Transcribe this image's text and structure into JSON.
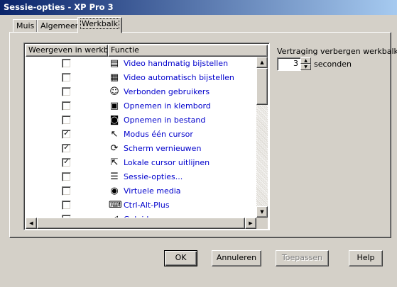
{
  "window": {
    "title": "Sessie-opties - XP Pro 3",
    "close_glyph": "×"
  },
  "tabs": [
    {
      "label": "Muis"
    },
    {
      "label": "Algemeen"
    },
    {
      "label": "Werkbalk",
      "active": true
    }
  ],
  "list": {
    "columns": [
      "Weergeven in werkb...",
      "Functie"
    ],
    "rows": [
      {
        "checked": "",
        "icon": "video-manual-icon",
        "label": "Video handmatig bijstellen"
      },
      {
        "checked": "",
        "icon": "video-auto-icon",
        "label": "Video automatisch bijstellen"
      },
      {
        "checked": "",
        "icon": "users-icon",
        "label": "Verbonden gebruikers"
      },
      {
        "checked": "",
        "icon": "clipboard-camera-icon",
        "label": "Opnemen in klembord"
      },
      {
        "checked": "",
        "icon": "file-camera-icon",
        "label": "Opnemen in bestand"
      },
      {
        "checked": "✓",
        "icon": "single-cursor-icon",
        "label": "Modus één cursor"
      },
      {
        "checked": "✓",
        "icon": "refresh-screen-icon",
        "label": "Scherm vernieuwen"
      },
      {
        "checked": "✓",
        "icon": "align-cursor-icon",
        "label": "Lokale cursor uitlijnen"
      },
      {
        "checked": "",
        "icon": "session-options-icon",
        "label": "Sessie-opties..."
      },
      {
        "checked": "",
        "icon": "virtual-media-icon",
        "label": "Virtuele media"
      },
      {
        "checked": "",
        "icon": "ctrl-alt-del-icon",
        "label": "Ctrl-Alt-Plus"
      },
      {
        "checked": "",
        "icon": "speaker-icon",
        "label": "Geluid..."
      }
    ]
  },
  "delay": {
    "label": "Vertraging verbergen werkbalk",
    "value": "3",
    "unit": "seconden"
  },
  "buttons": {
    "ok": "OK",
    "cancel": "Annuleren",
    "apply": "Toepassen",
    "help": "Help"
  }
}
